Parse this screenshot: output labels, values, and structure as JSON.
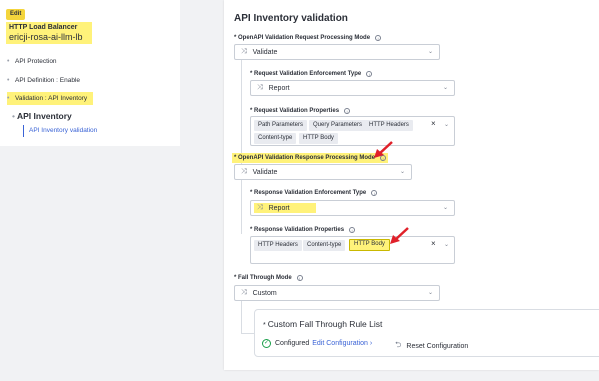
{
  "left": {
    "edit_badge": "Edit",
    "lb_title": "HTTP Load Balancer",
    "lb_name": "ericji-rosa-ai-llm-lb",
    "nav": [
      {
        "label": "API Protection"
      },
      {
        "label": "API Definition : Enable"
      },
      {
        "label": "Validation : API Inventory"
      }
    ],
    "section": "API Inventory",
    "sub_item": "API Inventory validation"
  },
  "right": {
    "title": "API Inventory validation",
    "req_mode": {
      "label": "* OpenAPI Validation Request Processing Mode",
      "value": "Validate"
    },
    "req_enforcement": {
      "label": "* Request Validation Enforcement Type",
      "value": "Report"
    },
    "req_properties": {
      "label": "* Request Validation Properties",
      "chips": [
        "Path Parameters",
        "Query Parameters",
        "HTTP Headers",
        "Content-type",
        "HTTP Body"
      ]
    },
    "resp_mode": {
      "label": "* OpenAPI Validation Response Processing Mode",
      "value": "Validate"
    },
    "resp_enforcement": {
      "label": "* Response Validation Enforcement Type",
      "value": "Report"
    },
    "resp_properties": {
      "label": "* Response Validation Properties",
      "chips": [
        "HTTP Headers",
        "Content-type",
        "HTTP Body"
      ]
    },
    "fall_through": {
      "label": "* Fall Through Mode",
      "value": "Custom"
    },
    "custom_list": {
      "title": "Custom Fall Through Rule List",
      "status": "Configured",
      "edit_link": "Edit Configuration",
      "reset": "Reset Configuration"
    }
  },
  "colors": {
    "highlight": "#fff27a",
    "link": "#3a63d6",
    "arrow": "#e0212a",
    "check": "#1a9f4a"
  }
}
